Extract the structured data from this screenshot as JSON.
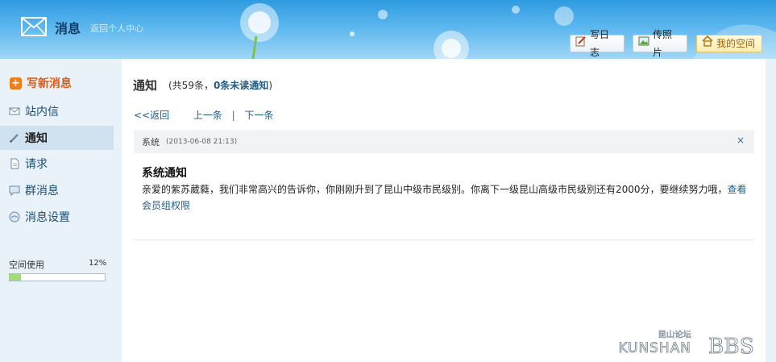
{
  "header": {
    "title": "消息",
    "back_link": "返回个人中心",
    "buttons": [
      {
        "label": "写日志",
        "icon": "edit-icon"
      },
      {
        "label": "传照片",
        "icon": "photo-icon"
      },
      {
        "label": "我的空间",
        "icon": "home-icon"
      }
    ]
  },
  "sidebar": {
    "compose_label": "写新消息",
    "items": [
      {
        "label": "站内信",
        "icon": "envelope-icon"
      },
      {
        "label": "通知",
        "icon": "pencil-icon",
        "active": true
      },
      {
        "label": "请求",
        "icon": "document-icon"
      },
      {
        "label": "群消息",
        "icon": "chat-icon"
      },
      {
        "label": "消息设置",
        "icon": "settings-icon"
      }
    ],
    "usage": {
      "label": "空间使用",
      "percent_text": "12%",
      "percent": 12
    }
  },
  "main": {
    "title": "通知",
    "count_prefix": "(共59条，",
    "count_unread": "0条未读通知",
    "count_suffix": ")",
    "pager": {
      "back": "<<返回",
      "prev": "上一条",
      "separator": "|",
      "next": "下一条"
    },
    "message": {
      "from": "系统",
      "time": "(2013-06-08 21:13)",
      "close": "×",
      "title": "系统通知",
      "body": "亲爱的紫苏葳蕤，我们非常高兴的告诉你，你刚刚升到了昆山中级市民级别。你离下一级昆山高级市民级别还有2000分，要继续努力哦，",
      "link": "查看会员组权限"
    }
  },
  "watermark": {
    "text_cn": "昆山论坛",
    "text_en": "KUNSHAN",
    "text_bbs": "BBS"
  },
  "colors": {
    "accent": "#1f5d8a",
    "compose": "#e05a13",
    "sidebar_bg": "#e9f2f9"
  }
}
